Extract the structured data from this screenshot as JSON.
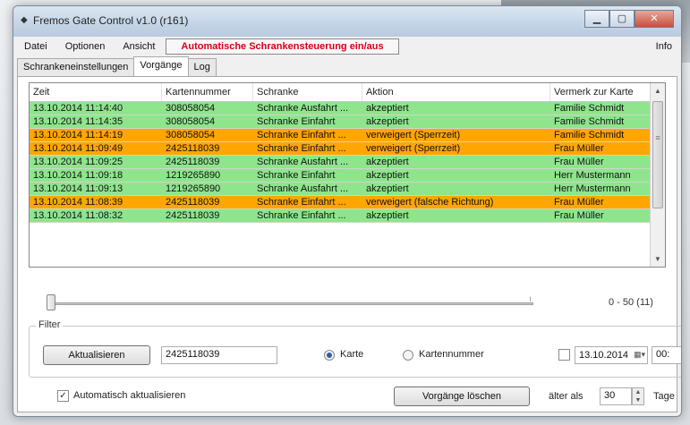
{
  "window": {
    "title": "Fremos Gate Control v1.0 (r161)"
  },
  "menu": {
    "items": [
      "Datei",
      "Optionen",
      "Ansicht"
    ],
    "highlight": "Automatische Schrankensteuerung ein/aus",
    "info": "Info"
  },
  "tabs": [
    "Schrankeneinstellungen",
    "Vorgänge",
    "Log"
  ],
  "active_tab": 1,
  "table": {
    "columns": [
      "Zeit",
      "Kartennummer",
      "Schranke",
      "Aktion",
      "Vermerk zur Karte"
    ],
    "rows": [
      {
        "status": "ok",
        "cells": [
          "13.10.2014 11:14:40",
          "308058054",
          "Schranke Ausfahrt ...",
          "akzeptiert",
          "Familie Schmidt"
        ]
      },
      {
        "status": "ok",
        "cells": [
          "13.10.2014 11:14:35",
          "308058054",
          "Schranke Einfahrt",
          "akzeptiert",
          "Familie Schmidt"
        ]
      },
      {
        "status": "deny",
        "cells": [
          "13.10.2014 11:14:19",
          "308058054",
          "Schranke Einfahrt ...",
          "verweigert (Sperrzeit)",
          "Familie Schmidt"
        ]
      },
      {
        "status": "deny",
        "cells": [
          "13.10.2014 11:09:49",
          "2425118039",
          "Schranke Einfahrt ...",
          "verweigert (Sperrzeit)",
          "Frau Müller"
        ]
      },
      {
        "status": "ok",
        "cells": [
          "13.10.2014 11:09:25",
          "2425118039",
          "Schranke Ausfahrt ...",
          "akzeptiert",
          "Frau Müller"
        ]
      },
      {
        "status": "ok",
        "cells": [
          "13.10.2014 11:09:18",
          "1219265890",
          "Schranke Einfahrt",
          "akzeptiert",
          "Herr Mustermann"
        ]
      },
      {
        "status": "ok",
        "cells": [
          "13.10.2014 11:09:13",
          "1219265890",
          "Schranke Ausfahrt ...",
          "akzeptiert",
          "Herr Mustermann"
        ]
      },
      {
        "status": "deny",
        "cells": [
          "13.10.2014 11:08:39",
          "2425118039",
          "Schranke Einfahrt ...",
          "verweigert (falsche Richtung)",
          "Frau Müller"
        ]
      },
      {
        "status": "ok",
        "cells": [
          "13.10.2014 11:08:32",
          "2425118039",
          "Schranke Einfahrt ...",
          "akzeptiert",
          "Frau Müller"
        ]
      }
    ]
  },
  "range_text": "0 - 50   (11)",
  "filter": {
    "legend": "Filter",
    "refresh_button": "Aktualisieren",
    "search_value": "2425118039",
    "radio_card_label": "Karte",
    "radio_cardnumber_label": "Kartennummer",
    "date_value": "13.10.2014",
    "time_value": "00:"
  },
  "footer": {
    "auto_refresh_label": "Automatisch aktualisieren",
    "delete_button": "Vorgänge löschen",
    "older_than_label": "älter als",
    "days_value": "30",
    "days_label": "Tage"
  },
  "colors": {
    "ok_row": "#8ee58c",
    "deny_row": "#ffa600",
    "menu_highlight_text": "#d4001a"
  }
}
